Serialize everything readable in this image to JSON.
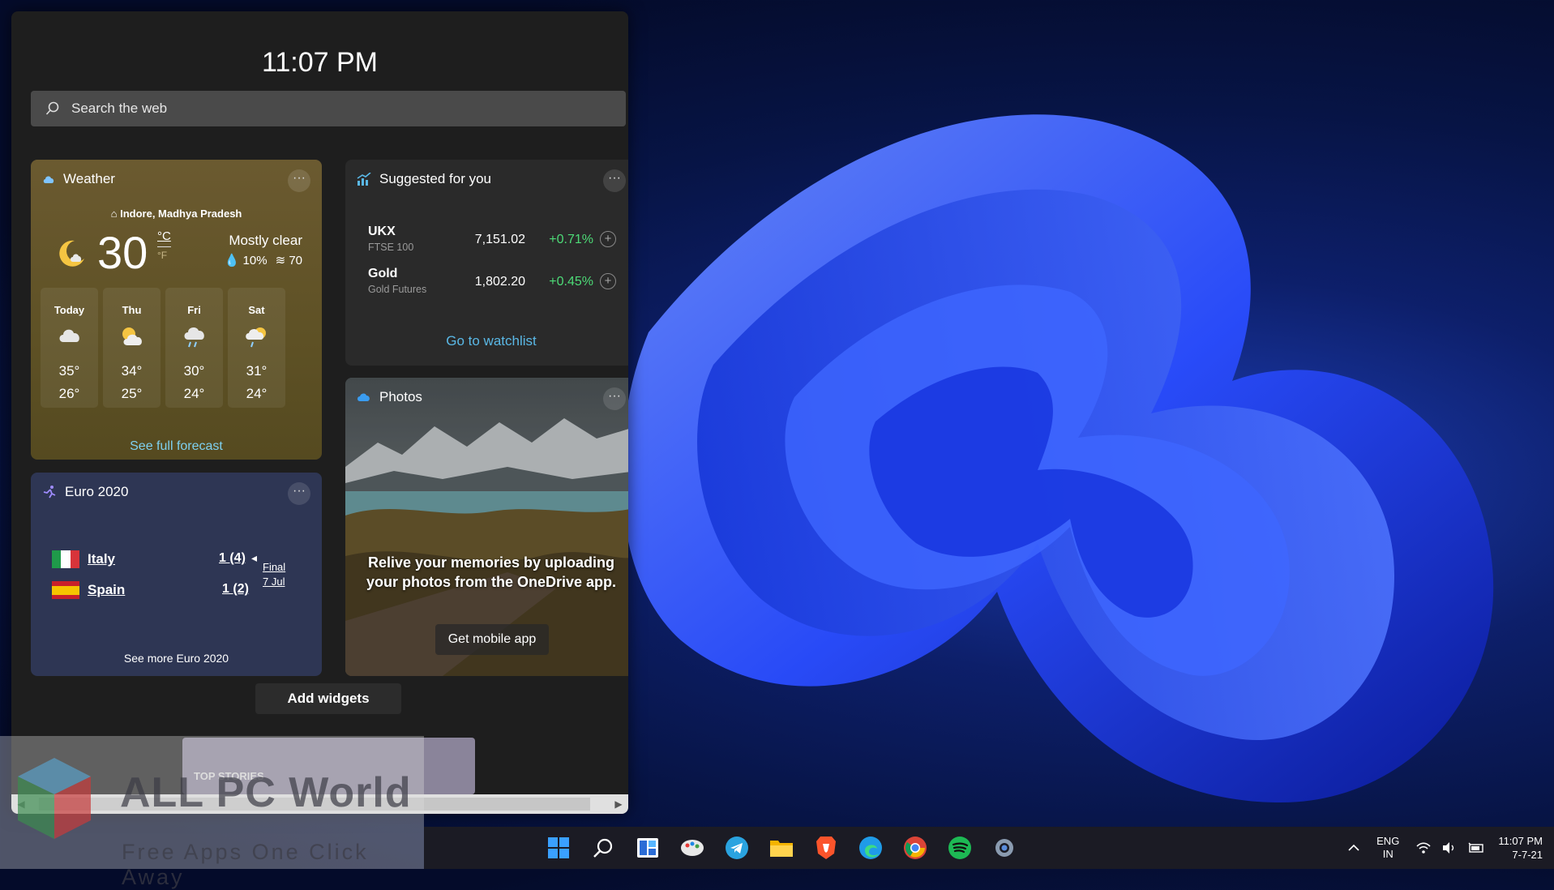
{
  "panel": {
    "clock": "11:07 PM",
    "search_placeholder": "Search the web"
  },
  "weather": {
    "title": "Weather",
    "location": "Indore, Madhya Pradesh",
    "temp": "30",
    "unit_c": "°C",
    "unit_f": "°F",
    "condition": "Mostly clear",
    "precip": "10%",
    "aqi": "70",
    "days": [
      {
        "name": "Today",
        "hi": "35°",
        "lo": "26°",
        "icon": "cloudy-icon"
      },
      {
        "name": "Thu",
        "hi": "34°",
        "lo": "25°",
        "icon": "partly-sunny-icon"
      },
      {
        "name": "Fri",
        "hi": "30°",
        "lo": "24°",
        "icon": "rain-icon"
      },
      {
        "name": "Sat",
        "hi": "31°",
        "lo": "24°",
        "icon": "sun-rain-icon"
      }
    ],
    "link": "See full forecast"
  },
  "suggested": {
    "title": "Suggested for you",
    "stocks": [
      {
        "name": "UKX",
        "sub": "FTSE 100",
        "price": "7,151.02",
        "change": "+0.71%"
      },
      {
        "name": "Gold",
        "sub": "Gold Futures",
        "price": "1,802.20",
        "change": "+0.45%"
      }
    ],
    "link": "Go to watchlist"
  },
  "photos": {
    "title": "Photos",
    "message": "Relive your memories by uploading your photos from the OneDrive app.",
    "button": "Get mobile app"
  },
  "euro": {
    "title": "Euro 2020",
    "teams": [
      {
        "name": "Italy",
        "score": "1 (4)"
      },
      {
        "name": "Spain",
        "score": "1 (2)"
      }
    ],
    "status": "Final",
    "date": "7 Jul",
    "link": "See more Euro 2020"
  },
  "add_widgets": "Add widgets",
  "top_stories": "TOP STORIES",
  "watermark": {
    "title": "ALL PC World",
    "subtitle": "Free Apps One Click Away"
  },
  "taskbar": {
    "apps": [
      "windows-start-icon",
      "search-icon",
      "widgets-icon",
      "paint-icon",
      "telegram-icon",
      "file-explorer-icon",
      "brave-icon",
      "edge-icon",
      "chrome-icon",
      "spotify-icon",
      "settings-icon"
    ],
    "lang_top": "ENG",
    "lang_bottom": "IN",
    "time": "11:07 PM",
    "date": "7-7-21"
  },
  "colors": {
    "positive": "#4ddb77",
    "link": "#5ab8e6",
    "panel": "#1e1e1e"
  }
}
